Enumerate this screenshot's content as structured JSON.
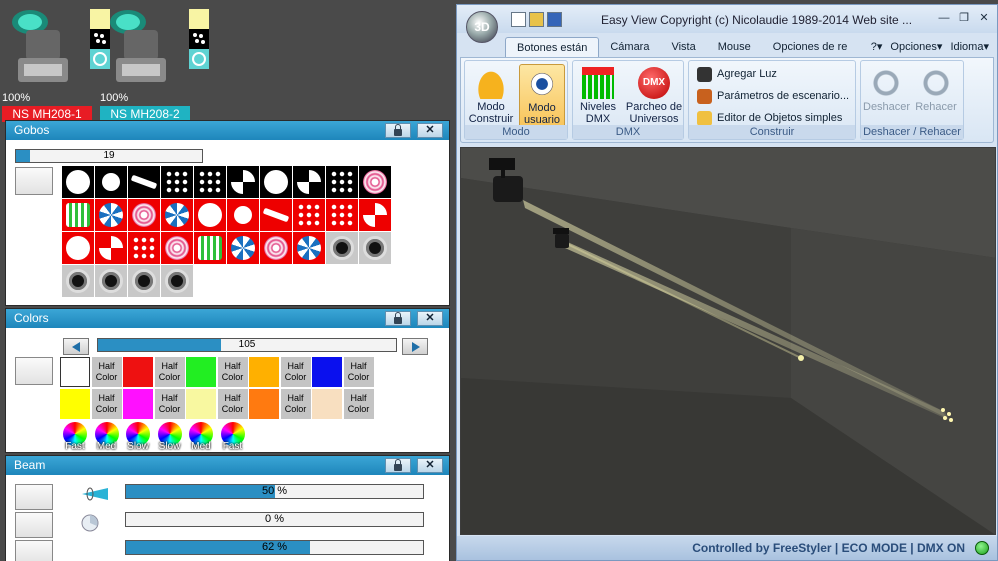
{
  "fixtures": [
    {
      "percent": "100%",
      "name": "NS MH208-1",
      "color": "#e81c24"
    },
    {
      "percent": "100%",
      "name": "NS MH208-2",
      "color": "#1fb3c2"
    }
  ],
  "gobos": {
    "title": "Gobos",
    "value": 19,
    "max": 100,
    "value_label": "19",
    "items": [
      "circle",
      "dot",
      "bar",
      "dots-scatter",
      "dots-ring",
      "tri-blades",
      "flower",
      "quad",
      "spiral-dots",
      "rings",
      "green-bars",
      "star-burst",
      "ring-texture",
      "star-burst",
      "circle",
      "dot",
      "bar",
      "dots-scatter",
      "dots-ring",
      "tri-blades",
      "flower",
      "quad",
      "spiral-dots",
      "rings",
      "green-bars",
      "star-burst",
      "ring-texture",
      "star-burst",
      "rotator-1",
      "rotator-2",
      "rotator-3",
      "rotator-4",
      "rotator-5",
      "rotator-6"
    ]
  },
  "colors": {
    "title": "Colors",
    "value": 105,
    "max": 255,
    "value_label": "105",
    "half_label_1": "Half",
    "half_label_2": "Color",
    "swatches": [
      "#ffffff",
      "#ee1111",
      "#22ee22",
      "#ffb000",
      "#0a10ee",
      "#ffff00",
      "#ff10ff",
      "#f8f8a0",
      "#ff7a10",
      "#f8dfc0"
    ],
    "wheels": [
      "Fast",
      "Med",
      "Slow",
      "Slow",
      "Med",
      "Fast"
    ]
  },
  "beam": {
    "title": "Beam",
    "rows": [
      {
        "icon": "zoom-icon",
        "value": 50,
        "label": "50 %"
      },
      {
        "icon": "pie-icon",
        "value": 0,
        "label": "0 %"
      },
      {
        "icon": "none",
        "value": 62,
        "label": "62 %"
      }
    ]
  },
  "window": {
    "orb": "3D",
    "title": "Easy View   Copyright (c) Nicolaudie 1989-2014   Web site ...",
    "tabs": [
      "Botones están",
      "Cámara",
      "Vista",
      "Mouse",
      "Opciones de re"
    ],
    "help": "?",
    "options": "Opciones",
    "language": "Idioma",
    "groups": {
      "modo": {
        "label": "Modo",
        "construir": "Modo Construir",
        "usuario": "Modo usuario"
      },
      "dmx": {
        "label": "DMX",
        "niveles": "Niveles DMX",
        "parcheo": "Parcheo de Universos",
        "dmx_icon": "DMX"
      },
      "construir": {
        "label": "Construir",
        "agregar": "Agregar Luz",
        "parametros": "Parámetros de escenario...",
        "editor": "Editor de Objetos simples"
      },
      "deshacer": {
        "label": "Deshacer / Rehacer",
        "undo": "Deshacer",
        "redo": "Rehacer"
      }
    },
    "status": "Controlled by FreeStyler   |   ECO MODE   |   DMX ON"
  }
}
